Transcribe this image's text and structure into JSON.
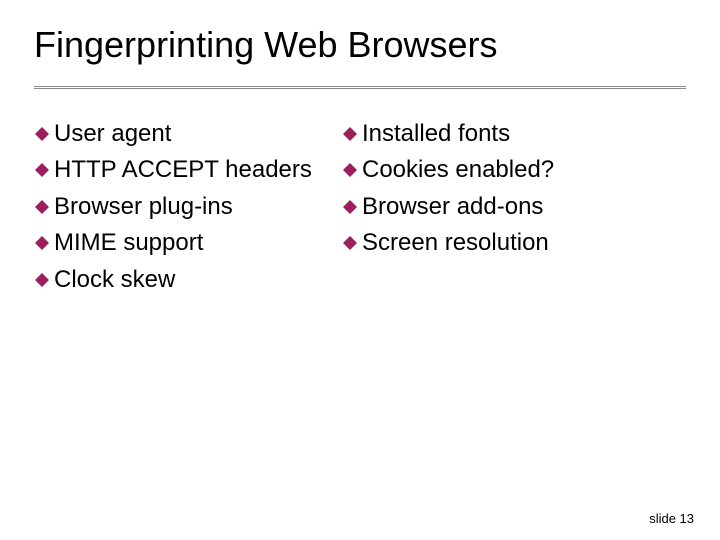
{
  "title": "Fingerprinting Web Browsers",
  "left_items": [
    "User agent",
    "HTTP ACCEPT headers",
    "Browser plug-ins",
    "MIME support",
    "Clock skew"
  ],
  "right_items": [
    "Installed fonts",
    "Cookies enabled?",
    "Browser add-ons",
    "Screen resolution"
  ],
  "footer": "slide 13",
  "bullet_color": "#9a1f5c"
}
